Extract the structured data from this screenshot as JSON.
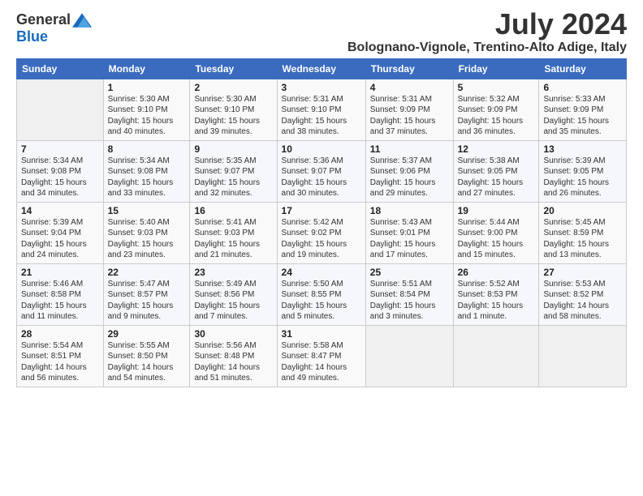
{
  "logo": {
    "general": "General",
    "blue": "Blue"
  },
  "title": "July 2024",
  "subtitle": "Bolognano-Vignole, Trentino-Alto Adige, Italy",
  "days_of_week": [
    "Sunday",
    "Monday",
    "Tuesday",
    "Wednesday",
    "Thursday",
    "Friday",
    "Saturday"
  ],
  "weeks": [
    [
      {
        "day": "",
        "info": ""
      },
      {
        "day": "1",
        "info": "Sunrise: 5:30 AM\nSunset: 9:10 PM\nDaylight: 15 hours\nand 40 minutes."
      },
      {
        "day": "2",
        "info": "Sunrise: 5:30 AM\nSunset: 9:10 PM\nDaylight: 15 hours\nand 39 minutes."
      },
      {
        "day": "3",
        "info": "Sunrise: 5:31 AM\nSunset: 9:10 PM\nDaylight: 15 hours\nand 38 minutes."
      },
      {
        "day": "4",
        "info": "Sunrise: 5:31 AM\nSunset: 9:09 PM\nDaylight: 15 hours\nand 37 minutes."
      },
      {
        "day": "5",
        "info": "Sunrise: 5:32 AM\nSunset: 9:09 PM\nDaylight: 15 hours\nand 36 minutes."
      },
      {
        "day": "6",
        "info": "Sunrise: 5:33 AM\nSunset: 9:09 PM\nDaylight: 15 hours\nand 35 minutes."
      }
    ],
    [
      {
        "day": "7",
        "info": "Sunrise: 5:34 AM\nSunset: 9:08 PM\nDaylight: 15 hours\nand 34 minutes."
      },
      {
        "day": "8",
        "info": "Sunrise: 5:34 AM\nSunset: 9:08 PM\nDaylight: 15 hours\nand 33 minutes."
      },
      {
        "day": "9",
        "info": "Sunrise: 5:35 AM\nSunset: 9:07 PM\nDaylight: 15 hours\nand 32 minutes."
      },
      {
        "day": "10",
        "info": "Sunrise: 5:36 AM\nSunset: 9:07 PM\nDaylight: 15 hours\nand 30 minutes."
      },
      {
        "day": "11",
        "info": "Sunrise: 5:37 AM\nSunset: 9:06 PM\nDaylight: 15 hours\nand 29 minutes."
      },
      {
        "day": "12",
        "info": "Sunrise: 5:38 AM\nSunset: 9:05 PM\nDaylight: 15 hours\nand 27 minutes."
      },
      {
        "day": "13",
        "info": "Sunrise: 5:39 AM\nSunset: 9:05 PM\nDaylight: 15 hours\nand 26 minutes."
      }
    ],
    [
      {
        "day": "14",
        "info": "Sunrise: 5:39 AM\nSunset: 9:04 PM\nDaylight: 15 hours\nand 24 minutes."
      },
      {
        "day": "15",
        "info": "Sunrise: 5:40 AM\nSunset: 9:03 PM\nDaylight: 15 hours\nand 23 minutes."
      },
      {
        "day": "16",
        "info": "Sunrise: 5:41 AM\nSunset: 9:03 PM\nDaylight: 15 hours\nand 21 minutes."
      },
      {
        "day": "17",
        "info": "Sunrise: 5:42 AM\nSunset: 9:02 PM\nDaylight: 15 hours\nand 19 minutes."
      },
      {
        "day": "18",
        "info": "Sunrise: 5:43 AM\nSunset: 9:01 PM\nDaylight: 15 hours\nand 17 minutes."
      },
      {
        "day": "19",
        "info": "Sunrise: 5:44 AM\nSunset: 9:00 PM\nDaylight: 15 hours\nand 15 minutes."
      },
      {
        "day": "20",
        "info": "Sunrise: 5:45 AM\nSunset: 8:59 PM\nDaylight: 15 hours\nand 13 minutes."
      }
    ],
    [
      {
        "day": "21",
        "info": "Sunrise: 5:46 AM\nSunset: 8:58 PM\nDaylight: 15 hours\nand 11 minutes."
      },
      {
        "day": "22",
        "info": "Sunrise: 5:47 AM\nSunset: 8:57 PM\nDaylight: 15 hours\nand 9 minutes."
      },
      {
        "day": "23",
        "info": "Sunrise: 5:49 AM\nSunset: 8:56 PM\nDaylight: 15 hours\nand 7 minutes."
      },
      {
        "day": "24",
        "info": "Sunrise: 5:50 AM\nSunset: 8:55 PM\nDaylight: 15 hours\nand 5 minutes."
      },
      {
        "day": "25",
        "info": "Sunrise: 5:51 AM\nSunset: 8:54 PM\nDaylight: 15 hours\nand 3 minutes."
      },
      {
        "day": "26",
        "info": "Sunrise: 5:52 AM\nSunset: 8:53 PM\nDaylight: 15 hours\nand 1 minute."
      },
      {
        "day": "27",
        "info": "Sunrise: 5:53 AM\nSunset: 8:52 PM\nDaylight: 14 hours\nand 58 minutes."
      }
    ],
    [
      {
        "day": "28",
        "info": "Sunrise: 5:54 AM\nSunset: 8:51 PM\nDaylight: 14 hours\nand 56 minutes."
      },
      {
        "day": "29",
        "info": "Sunrise: 5:55 AM\nSunset: 8:50 PM\nDaylight: 14 hours\nand 54 minutes."
      },
      {
        "day": "30",
        "info": "Sunrise: 5:56 AM\nSunset: 8:48 PM\nDaylight: 14 hours\nand 51 minutes."
      },
      {
        "day": "31",
        "info": "Sunrise: 5:58 AM\nSunset: 8:47 PM\nDaylight: 14 hours\nand 49 minutes."
      },
      {
        "day": "",
        "info": ""
      },
      {
        "day": "",
        "info": ""
      },
      {
        "day": "",
        "info": ""
      }
    ]
  ]
}
